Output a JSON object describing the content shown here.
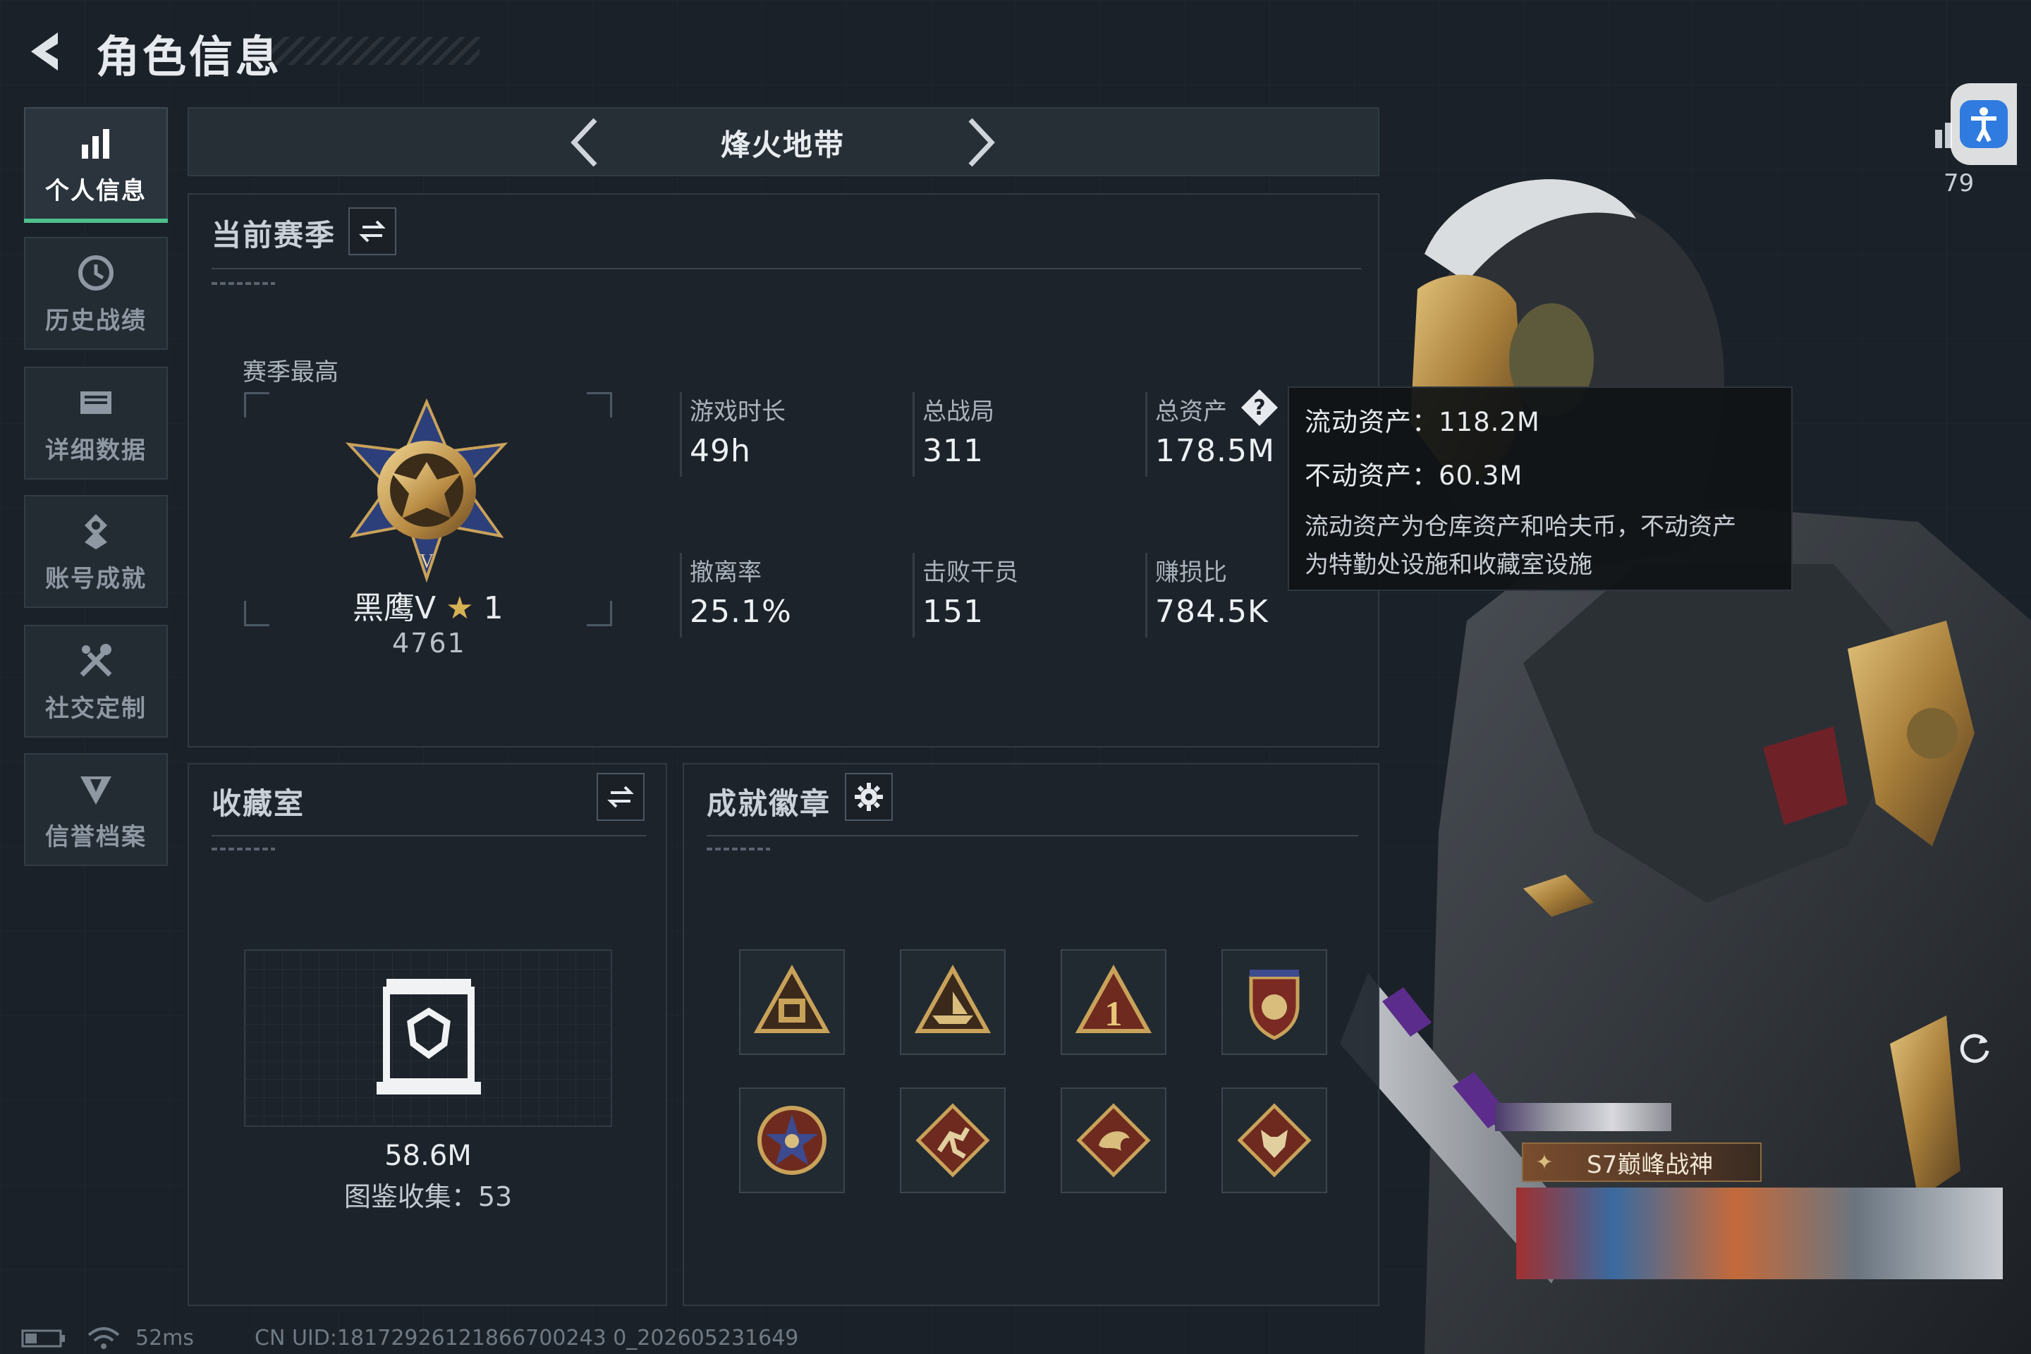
{
  "header": {
    "title": "角色信息"
  },
  "sidebar": {
    "items": [
      {
        "label": "个人信息",
        "icon": "bar-chart-icon",
        "active": true
      },
      {
        "label": "历史战绩",
        "icon": "clock-icon",
        "active": false
      },
      {
        "label": "详细数据",
        "icon": "folder-icon",
        "active": false
      },
      {
        "label": "账号成就",
        "icon": "achievement-icon",
        "active": false
      },
      {
        "label": "社交定制",
        "icon": "tools-icon",
        "active": false
      },
      {
        "label": "信誉档案",
        "icon": "shield-icon",
        "active": false
      }
    ]
  },
  "mode": {
    "name": "烽火地带"
  },
  "season": {
    "title": "当前赛季",
    "best_label": "赛季最高",
    "rank_name": "黑鹰V",
    "rank_stars": "1",
    "rank_score": "4761",
    "stats": [
      {
        "label": "游戏时长",
        "value": "49h"
      },
      {
        "label": "总战局",
        "value": "311"
      },
      {
        "label": "总资产",
        "value": "178.5M"
      },
      {
        "label": "撤离率",
        "value": "25.1%"
      },
      {
        "label": "击败干员",
        "value": "151"
      },
      {
        "label": "赚损比",
        "value": "784.5K"
      }
    ]
  },
  "tooltip": {
    "liquid": "流动资产：118.2M",
    "fixed": "不动资产：60.3M",
    "desc_line1": "流动资产为仓库资产和哈夫币，不动资产",
    "desc_line2": "为特勤处设施和收藏室设施"
  },
  "collection": {
    "title": "收藏室",
    "value": "58.6M",
    "catalog": "图鉴收集：53"
  },
  "badges": {
    "title": "成就徽章",
    "items": [
      "exchange-badge-icon",
      "triangle-boat-icon",
      "number-one-icon",
      "star-shield-icon",
      "star-compass-icon",
      "runner-diamond-icon",
      "dragon-diamond-icon",
      "wolf-diamond-icon"
    ]
  },
  "right_hud": {
    "level": "79",
    "title_plate": "S7巅峰战神"
  },
  "status": {
    "ping": "52ms",
    "uid": "CN UID:18172926121866700243 0_202605231649"
  },
  "colors": {
    "accent_green": "#4ec08c",
    "gold": "#c9a25a",
    "accessibility_blue": "#2f7be0"
  }
}
